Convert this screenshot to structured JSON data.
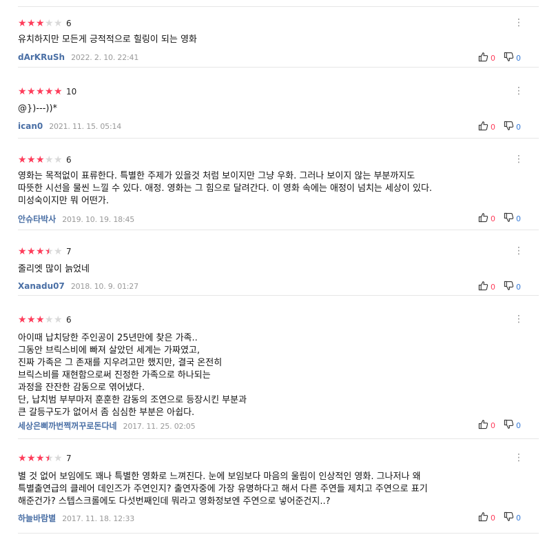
{
  "ui": {
    "more_icon": "more-vertical-icon",
    "like_icon": "thumbs-up-icon",
    "dislike_icon": "thumbs-down-icon",
    "star_on_color": "#fe3c5a",
    "star_off_color": "#d9d9d9",
    "like_count_color": "#fe3c5a",
    "dislike_count_color": "#3478d4",
    "author_color": "#4a6fa5"
  },
  "reviews": [
    {
      "rating": 6,
      "stars": [
        1,
        1,
        1,
        0,
        0
      ],
      "text": "유치하지만 모든게 긍적적으로 힐링이 되는 영화",
      "author": "dArKRuSh",
      "date": "2022. 2. 10. 22:41",
      "likes": "0",
      "dislikes": "0"
    },
    {
      "rating": 10,
      "stars": [
        1,
        1,
        1,
        1,
        1
      ],
      "text": "@})---))*",
      "author": "ican0",
      "date": "2021. 11. 15. 05:14",
      "likes": "0",
      "dislikes": "0"
    },
    {
      "rating": 6,
      "stars": [
        1,
        1,
        1,
        0,
        0
      ],
      "text": "영화는 목적없이 표류한다. 특별한 주제가 있을것 처럼 보이지만 그냥 우화. 그러나 보이지 않는 부분까지도\n따뜻한 시선을 물씬 느낄 수 있다. 애정. 영화는 그 힘으로 달려간다. 이 영화 속에는 애정이 넘치는 세상이 있다.\n미성숙이지만 뭐 어떤가.",
      "author": "안슈타박사",
      "date": "2019. 10. 19. 18:45",
      "likes": "0",
      "dislikes": "0"
    },
    {
      "rating": 7,
      "stars": [
        1,
        1,
        1,
        0.5,
        0
      ],
      "text": "줄리엣 많이 늙었네",
      "author": "Xanadu07",
      "date": "2018. 10. 9. 01:27",
      "likes": "0",
      "dislikes": "0"
    },
    {
      "rating": 6,
      "stars": [
        1,
        1,
        1,
        0,
        0
      ],
      "text": "아이때 납치당한 주인공이 25년만에 찾은 가족..\n그동안 브릭스비에 빠져 살았던 세계는 가짜였고,\n진짜 가족은 그 존재를 지우려고만 했지만, 결국 온전히\n브릭스비를 재현함으로써 진정한 가족으로 하나되는\n과정을 잔잔한 감동으로 엮어냈다.\n단, 납치범 부부마저 훈훈한 감동의 조연으로 등장시킨 부분과\n큰 갈등구도가 없어서 좀 심심한 부분은 아쉽다.",
      "author": "세상은삐까번쩍꺼꾸로돈다네",
      "date": "2017. 11. 25. 02:05",
      "likes": "0",
      "dislikes": "0"
    },
    {
      "rating": 7,
      "stars": [
        1,
        1,
        1,
        0.5,
        0
      ],
      "text": "별 것 없어 보임에도 꽤나 특별한 영화로 느껴진다. 눈에 보임보다 마음의 울림이 인상적인 영화. 그나저나 왜\n특별출연급의 클레어 데인즈가 주연인지? 출연자중에 가장 유명하다고 해서 다른 주연들 제치고 주연으로 표기\n해준건가? 스텝스크롤에도 다섯번째인데 뭐라고 영화정보엔 주연으로 넣어준건지..?",
      "author": "하늘바람별",
      "date": "2017. 11. 18. 12:33",
      "likes": "0",
      "dislikes": "0"
    }
  ]
}
